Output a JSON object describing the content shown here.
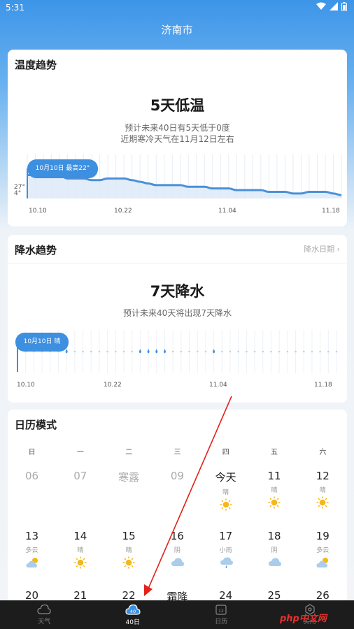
{
  "status": {
    "time": "5:31"
  },
  "city": "济南市",
  "temp_card": {
    "title": "温度趋势",
    "headline": "5天低温",
    "line1": "预计未来40日有5天低于0度",
    "line2": "近期寒冷天气在11月12日左右",
    "bubble": "10月10日 最高22°",
    "y_high": "27°",
    "y_low": "4°",
    "ticks": [
      "10.10",
      "10.22",
      "11.04",
      "11.18"
    ]
  },
  "rain_card": {
    "title": "降水趋势",
    "link": "降水日期",
    "headline": "7天降水",
    "line1": "预计未来40天将出现7天降水",
    "bubble": "10月10日 晴",
    "ticks": [
      "10.10",
      "10.22",
      "11.04",
      "11.18"
    ]
  },
  "calendar": {
    "title": "日历模式",
    "weekdays": [
      "日",
      "一",
      "二",
      "三",
      "四",
      "五",
      "六"
    ],
    "row1": [
      {
        "day": "06",
        "w": ""
      },
      {
        "day": "07",
        "w": ""
      },
      {
        "day": "寒露",
        "w": ""
      },
      {
        "day": "09",
        "w": ""
      },
      {
        "day": "今天",
        "w": "晴"
      },
      {
        "day": "11",
        "w": "晴"
      },
      {
        "day": "12",
        "w": "晴"
      }
    ],
    "row2": [
      {
        "day": "13",
        "w": "多云"
      },
      {
        "day": "14",
        "w": "晴"
      },
      {
        "day": "15",
        "w": "晴"
      },
      {
        "day": "16",
        "w": "阴"
      },
      {
        "day": "17",
        "w": "小雨"
      },
      {
        "day": "18",
        "w": "阴"
      },
      {
        "day": "19",
        "w": "多云"
      }
    ],
    "row3": [
      {
        "day": "20"
      },
      {
        "day": "21"
      },
      {
        "day": "22"
      },
      {
        "day": "霜降"
      },
      {
        "day": "24"
      },
      {
        "day": "25"
      },
      {
        "day": "26"
      }
    ]
  },
  "nav": {
    "weather": "天气",
    "forty": "40日",
    "calendar": "日历",
    "tools": "实用",
    "calendar_icon_num": "12",
    "forty_icon_num": "40"
  },
  "watermark": "php中文网",
  "colors": {
    "accent": "#3d8fe0",
    "sun": "#f5b818",
    "line": "#4a90d9"
  },
  "chart_data": [
    {
      "type": "line",
      "title": "温度趋势",
      "x_ticks": [
        "10.10",
        "10.22",
        "11.04",
        "11.18"
      ],
      "series": [
        {
          "values": [
            22,
            22,
            23,
            23,
            22,
            20,
            20,
            20,
            19,
            19,
            20,
            20,
            20,
            19,
            18,
            17,
            16,
            16,
            16,
            16,
            15,
            15,
            15,
            14,
            14,
            14,
            13,
            13,
            13,
            13,
            12,
            12,
            12,
            11,
            11,
            12,
            12,
            12,
            11,
            10
          ]
        }
      ]
    },
    {
      "type": "scatter",
      "title": "降水趋势",
      "x_ticks": [
        "10.10",
        "10.22",
        "11.04",
        "11.18"
      ],
      "rain_day_index": [
        6,
        15,
        16,
        17,
        18,
        24
      ]
    }
  ]
}
